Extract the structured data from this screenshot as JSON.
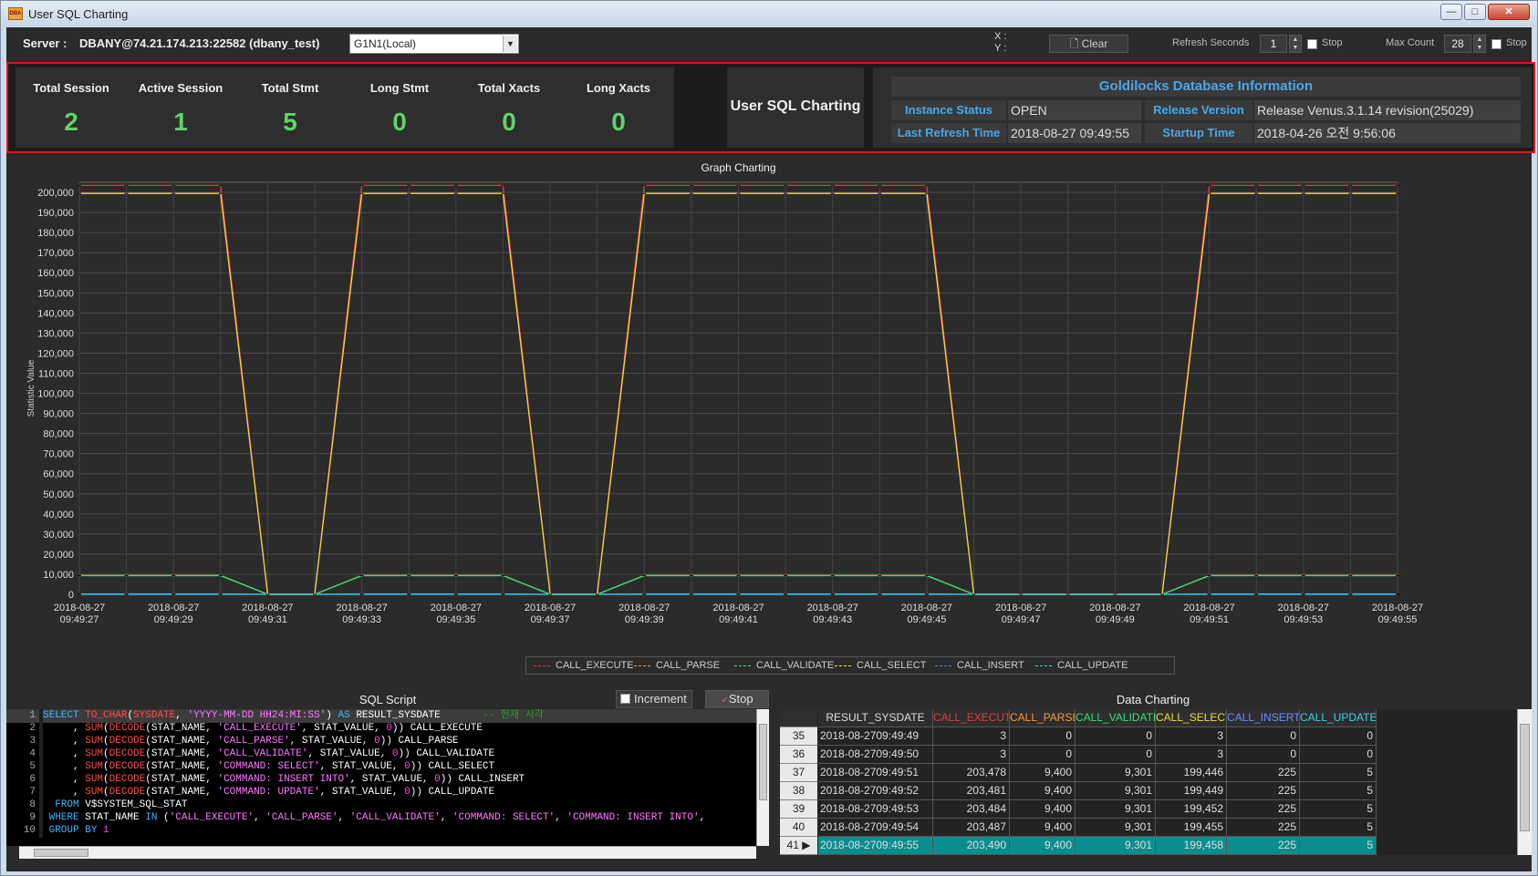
{
  "window": {
    "title": "User SQL Charting",
    "icon_text": "DBA",
    "minimize": "—",
    "maximize": "□",
    "close": "✕"
  },
  "toolbar": {
    "server_label": "Server :",
    "server_value": "DBANY@74.21.174.213:22582 (dbany_test)",
    "node_select": "G1N1(Local)",
    "x_label": "X :",
    "y_label": "Y :",
    "clear": "Clear",
    "refresh_label": "Refresh Seconds",
    "refresh_value": "1",
    "stop1": "Stop",
    "max_label": "Max Count",
    "max_value": "28",
    "stop2": "Stop"
  },
  "summary": {
    "cards": [
      {
        "title": "Total Session",
        "value": "2"
      },
      {
        "title": "Active Session",
        "value": "1"
      },
      {
        "title": "Total Stmt",
        "value": "5"
      },
      {
        "title": "Long Stmt",
        "value": "0"
      },
      {
        "title": "Total Xacts",
        "value": "0"
      },
      {
        "title": "Long Xacts",
        "value": "0"
      }
    ],
    "chart_title": "User SQL Charting",
    "info": {
      "title": "Goldilocks Database Information",
      "instance_status_label": "Instance Status",
      "instance_status": "OPEN",
      "release_label": "Release Version",
      "release": "Release Venus.3.1.14 revision(25029)",
      "last_refresh_label": "Last Refresh Time",
      "last_refresh": "2018-08-27 09:49:55",
      "startup_label": "Startup Time",
      "startup": "2018-04-26 오전 9:56:06"
    }
  },
  "chart_data": {
    "type": "line",
    "title": "Graph Charting",
    "ylabel": "Statistic Value",
    "ylim": [
      0,
      205000
    ],
    "grid": true,
    "legend_position": "bottom",
    "yticks": [
      "200,000",
      "190,000",
      "180,000",
      "170,000",
      "160,000",
      "150,000",
      "140,000",
      "130,000",
      "120,000",
      "110,000",
      "100,000",
      "90,000",
      "80,000",
      "70,000",
      "60,000",
      "50,000",
      "40,000",
      "30,000",
      "20,000",
      "10,000",
      "0"
    ],
    "xticks": [
      [
        "2018-08-27",
        "09:49:27"
      ],
      [
        "2018-08-27",
        "09:49:29"
      ],
      [
        "2018-08-27",
        "09:49:31"
      ],
      [
        "2018-08-27",
        "09:49:33"
      ],
      [
        "2018-08-27",
        "09:49:35"
      ],
      [
        "2018-08-27",
        "09:49:37"
      ],
      [
        "2018-08-27",
        "09:49:39"
      ],
      [
        "2018-08-27",
        "09:49:41"
      ],
      [
        "2018-08-27",
        "09:49:43"
      ],
      [
        "2018-08-27",
        "09:49:45"
      ],
      [
        "2018-08-27",
        "09:49:47"
      ],
      [
        "2018-08-27",
        "09:49:49"
      ],
      [
        "2018-08-27",
        "09:49:51"
      ],
      [
        "2018-08-27",
        "09:49:53"
      ],
      [
        "2018-08-27",
        "09:49:55"
      ]
    ],
    "pattern": [
      1,
      1,
      1,
      1,
      0,
      0,
      1,
      1,
      1,
      1,
      0,
      0,
      1,
      1,
      1,
      1,
      1,
      1,
      1,
      0,
      0,
      0,
      0,
      0,
      1,
      1,
      1,
      1,
      1
    ],
    "series": [
      {
        "name": "CALL_EXECUTE",
        "color": "#e03c3c",
        "on": 203480,
        "off": 3
      },
      {
        "name": "CALL_PARSE",
        "color": "#f29a3a",
        "on": 9400,
        "off": 0
      },
      {
        "name": "CALL_VALIDATE",
        "color": "#3ddc78",
        "on": 9301,
        "off": 0
      },
      {
        "name": "CALL_SELECT",
        "color": "#f0d84a",
        "on": 199450,
        "off": 3
      },
      {
        "name": "CALL_INSERT",
        "color": "#4a7df0",
        "on": 225,
        "off": 0
      },
      {
        "name": "CALL_UPDATE",
        "color": "#3ed0e0",
        "on": 5,
        "off": 0
      }
    ]
  },
  "sql": {
    "title": "SQL Script",
    "increment": "Increment",
    "stop": "Stop",
    "lines": [
      [
        [
          "kw",
          "SELECT "
        ],
        [
          "fn",
          "TO_CHAR"
        ],
        [
          "txt",
          "("
        ],
        [
          "fn",
          "SYSDATE"
        ],
        [
          "txt",
          ", "
        ],
        [
          "str",
          "'YYYY-MM-DD HH24:MI:SS'"
        ],
        [
          "txt",
          ") "
        ],
        [
          "kw",
          "AS "
        ],
        [
          "txt",
          "RESULT_SYSDATE"
        ],
        [
          "cm",
          "       -- 현재 시각"
        ]
      ],
      [
        [
          "txt",
          "     , "
        ],
        [
          "fn",
          "SUM"
        ],
        [
          "txt",
          "("
        ],
        [
          "fn",
          "DECODE"
        ],
        [
          "txt",
          "(STAT_NAME, "
        ],
        [
          "str",
          "'CALL_EXECUTE'"
        ],
        [
          "txt",
          ", STAT_VALUE, "
        ],
        [
          "num",
          "0"
        ],
        [
          "txt",
          ")) CALL_EXECUTE"
        ]
      ],
      [
        [
          "txt",
          "     , "
        ],
        [
          "fn",
          "SUM"
        ],
        [
          "txt",
          "("
        ],
        [
          "fn",
          "DECODE"
        ],
        [
          "txt",
          "(STAT_NAME, "
        ],
        [
          "str",
          "'CALL_PARSE'"
        ],
        [
          "txt",
          ", STAT_VALUE, "
        ],
        [
          "num",
          "0"
        ],
        [
          "txt",
          ")) CALL_PARSE"
        ]
      ],
      [
        [
          "txt",
          "     , "
        ],
        [
          "fn",
          "SUM"
        ],
        [
          "txt",
          "("
        ],
        [
          "fn",
          "DECODE"
        ],
        [
          "txt",
          "(STAT_NAME, "
        ],
        [
          "str",
          "'CALL_VALIDATE'"
        ],
        [
          "txt",
          ", STAT_VALUE, "
        ],
        [
          "num",
          "0"
        ],
        [
          "txt",
          ")) CALL_VALIDATE"
        ]
      ],
      [
        [
          "txt",
          "     , "
        ],
        [
          "fn",
          "SUM"
        ],
        [
          "txt",
          "("
        ],
        [
          "fn",
          "DECODE"
        ],
        [
          "txt",
          "(STAT_NAME, "
        ],
        [
          "str",
          "'COMMAND: SELECT'"
        ],
        [
          "txt",
          ", STAT_VALUE, "
        ],
        [
          "num",
          "0"
        ],
        [
          "txt",
          ")) CALL_SELECT"
        ]
      ],
      [
        [
          "txt",
          "     , "
        ],
        [
          "fn",
          "SUM"
        ],
        [
          "txt",
          "("
        ],
        [
          "fn",
          "DECODE"
        ],
        [
          "txt",
          "(STAT_NAME, "
        ],
        [
          "str",
          "'COMMAND: INSERT INTO'"
        ],
        [
          "txt",
          ", STAT_VALUE, "
        ],
        [
          "num",
          "0"
        ],
        [
          "txt",
          ")) CALL_INSERT"
        ]
      ],
      [
        [
          "txt",
          "     , "
        ],
        [
          "fn",
          "SUM"
        ],
        [
          "txt",
          "("
        ],
        [
          "fn",
          "DECODE"
        ],
        [
          "txt",
          "(STAT_NAME, "
        ],
        [
          "str",
          "'COMMAND: UPDATE'"
        ],
        [
          "txt",
          ", STAT_VALUE, "
        ],
        [
          "num",
          "0"
        ],
        [
          "txt",
          ")) CALL_UPDATE"
        ]
      ],
      [
        [
          "txt",
          "  "
        ],
        [
          "kw",
          "FROM "
        ],
        [
          "txt",
          "V$SYSTEM_SQL_STAT"
        ]
      ],
      [
        [
          "txt",
          " "
        ],
        [
          "kw",
          "WHERE "
        ],
        [
          "txt",
          "STAT_NAME "
        ],
        [
          "kw",
          "IN "
        ],
        [
          "txt",
          "("
        ],
        [
          "str",
          "'CALL_EXECUTE'"
        ],
        [
          "txt",
          ", "
        ],
        [
          "str",
          "'CALL_PARSE'"
        ],
        [
          "txt",
          ", "
        ],
        [
          "str",
          "'CALL_VALIDATE'"
        ],
        [
          "txt",
          ", "
        ],
        [
          "str",
          "'COMMAND: SELECT'"
        ],
        [
          "txt",
          ", "
        ],
        [
          "str",
          "'COMMAND: INSERT INTO'"
        ],
        [
          "txt",
          ","
        ]
      ],
      [
        [
          "txt",
          " "
        ],
        [
          "kw",
          "GROUP BY "
        ],
        [
          "num",
          "1"
        ]
      ]
    ]
  },
  "grid": {
    "title": "Data Charting",
    "columns": [
      {
        "name": "RESULT_SYSDATE",
        "color": "#dddddd"
      },
      {
        "name": "CALL_EXECUTE",
        "color": "#e03c3c"
      },
      {
        "name": "CALL_PARSE",
        "color": "#f29a3a"
      },
      {
        "name": "CALL_VALIDATE",
        "color": "#3ddc78"
      },
      {
        "name": "CALL_SELECT",
        "color": "#f0d84a"
      },
      {
        "name": "CALL_INSERT",
        "color": "#6b8cff"
      },
      {
        "name": "CALL_UPDATE",
        "color": "#3ed0e0"
      }
    ],
    "rows": [
      {
        "n": "35",
        "cells": [
          "2018-08-2709:49:49",
          "3",
          "0",
          "0",
          "3",
          "0",
          "0"
        ]
      },
      {
        "n": "36",
        "cells": [
          "2018-08-2709:49:50",
          "3",
          "0",
          "0",
          "3",
          "0",
          "0"
        ]
      },
      {
        "n": "37",
        "cells": [
          "2018-08-2709:49:51",
          "203,478",
          "9,400",
          "9,301",
          "199,446",
          "225",
          "5"
        ]
      },
      {
        "n": "38",
        "cells": [
          "2018-08-2709:49:52",
          "203,481",
          "9,400",
          "9,301",
          "199,449",
          "225",
          "5"
        ]
      },
      {
        "n": "39",
        "cells": [
          "2018-08-2709:49:53",
          "203,484",
          "9,400",
          "9,301",
          "199,452",
          "225",
          "5"
        ]
      },
      {
        "n": "40",
        "cells": [
          "2018-08-2709:49:54",
          "203,487",
          "9,400",
          "9,301",
          "199,455",
          "225",
          "5"
        ]
      },
      {
        "n": "41",
        "cells": [
          "2018-08-2709:49:55",
          "203,490",
          "9,400",
          "9,301",
          "199,458",
          "225",
          "5"
        ],
        "selected": true
      }
    ]
  }
}
